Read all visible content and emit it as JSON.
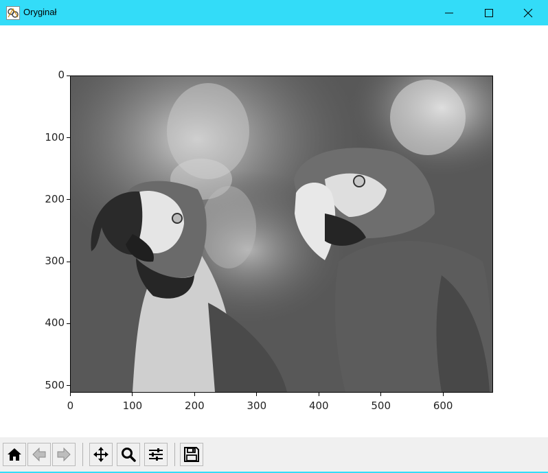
{
  "window": {
    "title": "Oryginał",
    "title_bar_color": "#33dcf8",
    "controls": [
      "minimize-icon",
      "maximize-icon",
      "close-icon"
    ]
  },
  "figure": {
    "image_description": "grayscale photograph of two macaw parrots",
    "x_ticks": [
      "0",
      "100",
      "200",
      "300",
      "400",
      "500",
      "600"
    ],
    "y_ticks": [
      "0",
      "100",
      "200",
      "300",
      "400",
      "500"
    ]
  },
  "toolbar": {
    "buttons": [
      {
        "name": "home",
        "icon": "home-icon"
      },
      {
        "name": "back",
        "icon": "arrow-left-icon"
      },
      {
        "name": "forward",
        "icon": "arrow-right-icon"
      },
      {
        "name": "pan",
        "icon": "move-icon"
      },
      {
        "name": "zoom",
        "icon": "magnifier-icon"
      },
      {
        "name": "configure-subplots",
        "icon": "sliders-icon"
      },
      {
        "name": "save",
        "icon": "floppy-disk-icon"
      }
    ]
  }
}
